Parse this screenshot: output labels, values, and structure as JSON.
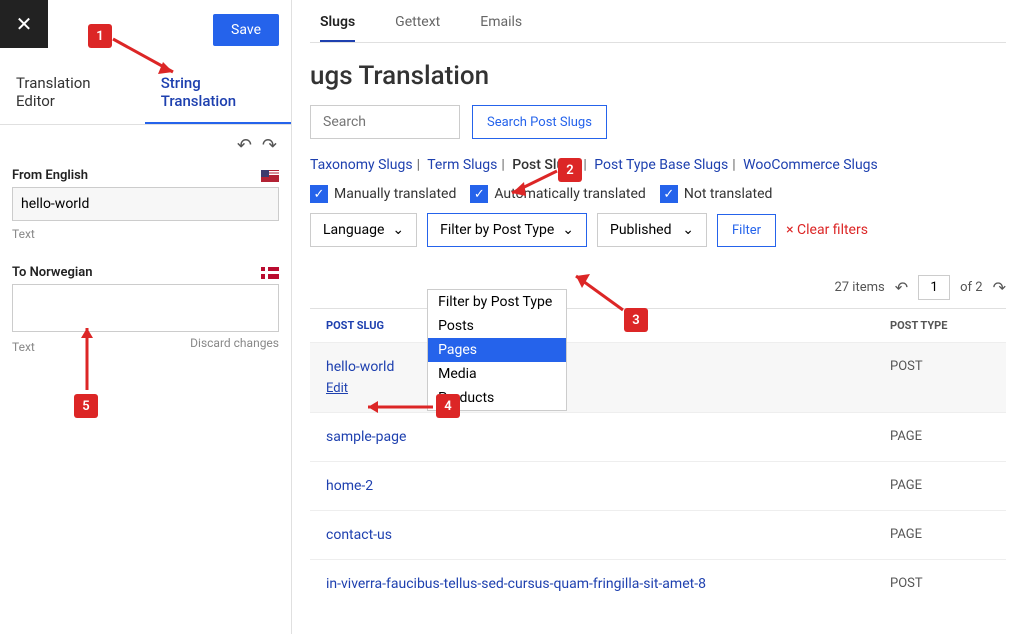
{
  "sidebar": {
    "save_label": "Save",
    "tabs": {
      "translation_editor": "Translation Editor",
      "string_translation": "String Translation"
    },
    "from_label": "From English",
    "from_value": "hello-world",
    "from_type": "Text",
    "to_label": "To Norwegian",
    "to_type": "Text",
    "discard": "Discard changes"
  },
  "main": {
    "tabs": {
      "slugs": "Slugs",
      "gettext": "Gettext",
      "emails": "Emails"
    },
    "title": "ugs Translation",
    "search_placeholder": "Search",
    "search_btn": "Search Post Slugs",
    "slug_nav": {
      "taxonomy": "Taxonomy Slugs",
      "term": "Term Slugs",
      "post": "Post Slugs",
      "post_type_base": "Post Type Base Slugs",
      "woocommerce": "WooCommerce Slugs"
    },
    "filters": {
      "manually": "Manually translated",
      "automatically": "Automatically translated",
      "not": "Not translated",
      "language": "Language",
      "post_type": "Filter by Post Type",
      "published": "Published",
      "filter_btn": "Filter",
      "clear": "Clear filters",
      "clear_x": "×"
    },
    "dropdown": {
      "opt0": "Filter by Post Type",
      "opt1": "Posts",
      "opt2": "Pages",
      "opt3": "Media",
      "opt4": "Products"
    },
    "pagination": {
      "items": "27 items",
      "page": "1",
      "of": "of 2"
    },
    "table": {
      "col1": "POST SLUG",
      "col2": "POST TYPE",
      "rows": [
        {
          "slug": "hello-world",
          "type": "POST",
          "edit": "Edit"
        },
        {
          "slug": "sample-page",
          "type": "PAGE"
        },
        {
          "slug": "home-2",
          "type": "PAGE"
        },
        {
          "slug": "contact-us",
          "type": "PAGE"
        },
        {
          "slug": "in-viverra-faucibus-tellus-sed-cursus-quam-fringilla-sit-amet-8",
          "type": "POST"
        }
      ]
    }
  },
  "annotations": {
    "a1": "1",
    "a2": "2",
    "a3": "3",
    "a4": "4",
    "a5": "5"
  }
}
